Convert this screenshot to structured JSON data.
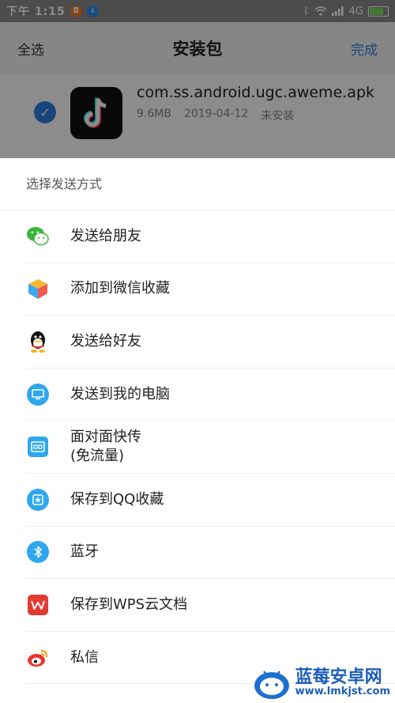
{
  "status_bar": {
    "time": "下午 1:15",
    "network": "4G"
  },
  "header": {
    "select_all": "全选",
    "title": "安装包",
    "done": "完成"
  },
  "file": {
    "name": "com.ss.android.ugc.aweme.apk",
    "size": "9.6MB",
    "date": "2019-04-12",
    "status": "未安装"
  },
  "share_sheet": {
    "title": "选择发送方式",
    "items": [
      {
        "label": "发送给朋友",
        "icon": "wechat-icon"
      },
      {
        "label": "添加到微信收藏",
        "icon": "wechat-favorites-icon"
      },
      {
        "label": "发送给好友",
        "icon": "qq-icon"
      },
      {
        "label": "发送到我的电脑",
        "icon": "computer-icon"
      },
      {
        "label": "面对面快传\n(免流量)",
        "icon": "face-to-face-icon"
      },
      {
        "label": "保存到QQ收藏",
        "icon": "qq-favorites-icon"
      },
      {
        "label": "蓝牙",
        "icon": "bluetooth-icon"
      },
      {
        "label": "保存到WPS云文档",
        "icon": "wps-icon"
      },
      {
        "label": "私信",
        "icon": "weibo-icon"
      }
    ]
  },
  "watermark": {
    "brand": "蓝莓安卓网",
    "url": "www.lmkjst.com"
  },
  "colors": {
    "accent": "#2f7ee3",
    "wechat": "#3bb53b",
    "wps": "#e23b32"
  }
}
